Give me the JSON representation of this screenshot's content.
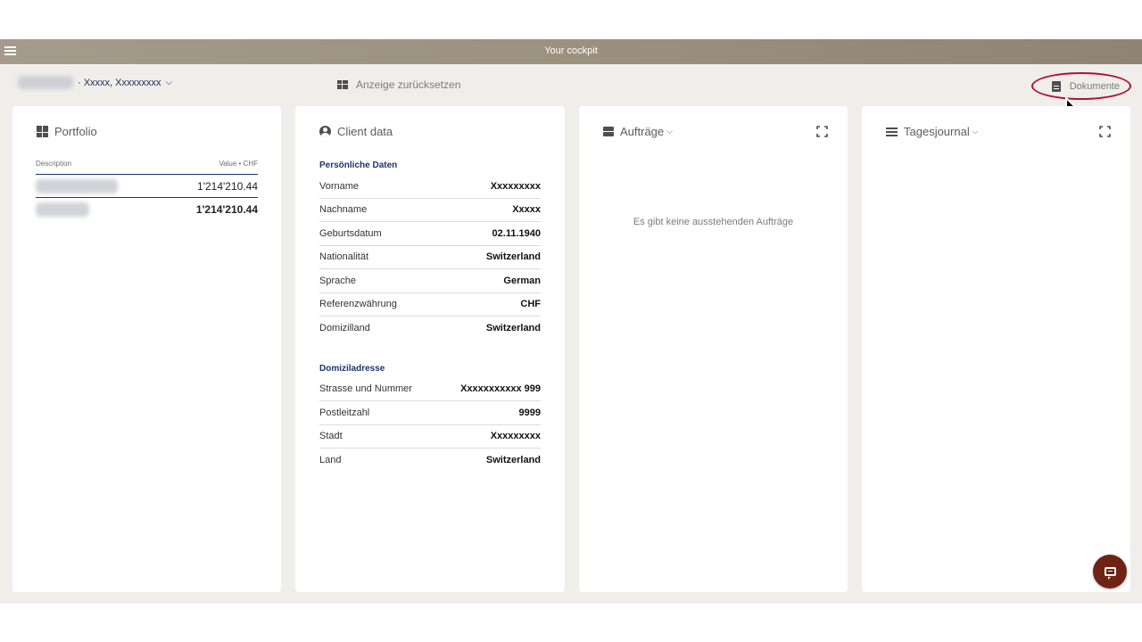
{
  "header": {
    "title": "Your cockpit",
    "menu_icon": "hamburger-icon"
  },
  "subbar": {
    "client_name": "· Xxxxx, Xxxxxxxxx",
    "client_chevron": "⌵",
    "reset_label": "Anzeige zurücksetzen",
    "documents_label": "Dokumente"
  },
  "colors": {
    "header_bg": "#9c917f",
    "app_bg": "#efeeea",
    "accent_navy": "#1f3370",
    "highlight_circle": "#b3122e",
    "chat_button": "#6e2414"
  },
  "portfolio": {
    "title": "Portfolio",
    "col_description": "Description",
    "col_value": "Value • CHF",
    "rows": [
      {
        "value": "1'214'210.44"
      },
      {
        "value": "1'214'210.44"
      }
    ]
  },
  "client_data": {
    "title": "Client data",
    "personal_heading": "Persönliche Daten",
    "personal": [
      {
        "label": "Vorname",
        "value": "Xxxxxxxxx"
      },
      {
        "label": "Nachname",
        "value": "Xxxxx"
      },
      {
        "label": "Geburtsdatum",
        "value": "02.11.1940"
      },
      {
        "label": "Nationalität",
        "value": "Switzerland"
      },
      {
        "label": "Sprache",
        "value": "German"
      },
      {
        "label": "Referenzwährung",
        "value": "CHF"
      },
      {
        "label": "Domizilland",
        "value": "Switzerland"
      }
    ],
    "address_heading": "Domiziladresse",
    "address": [
      {
        "label": "Strasse und Nummer",
        "value": "Xxxxxxxxxxx 999"
      },
      {
        "label": "Postleitzahl",
        "value": "9999"
      },
      {
        "label": "Stadt",
        "value": "Xxxxxxxxx"
      },
      {
        "label": "Land",
        "value": "Switzerland"
      }
    ]
  },
  "orders": {
    "title": "Aufträge",
    "chevron": "⌵",
    "empty_text": "Es gibt keine ausstehenden Aufträge"
  },
  "journal": {
    "title": "Tagesjournal",
    "chevron": "⌵"
  }
}
